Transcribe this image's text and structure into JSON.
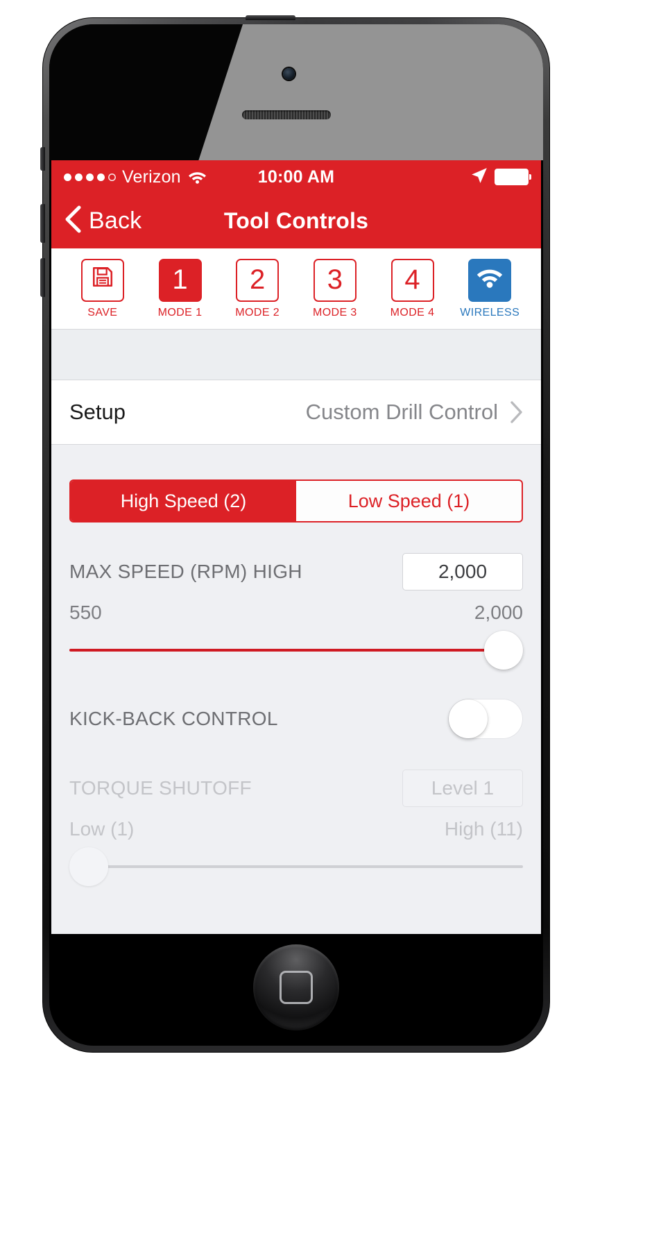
{
  "status_bar": {
    "carrier": "Verizon",
    "time": "10:00 AM",
    "signal_dots_filled": 4,
    "signal_dots_total": 5,
    "wifi_icon": "wifi-icon",
    "location_icon": "location-arrow-icon",
    "battery_icon": "battery-full-icon"
  },
  "nav_bar": {
    "back_label": "Back",
    "back_icon": "chevron-left-icon",
    "title": "Tool Controls"
  },
  "toolbar": {
    "items": [
      {
        "glyph": "",
        "caption": "SAVE",
        "icon": "floppy-disk-save-icon",
        "state": "outline"
      },
      {
        "glyph": "1",
        "caption": "MODE 1",
        "icon": "mode-1-icon",
        "state": "active"
      },
      {
        "glyph": "2",
        "caption": "MODE 2",
        "icon": "mode-2-icon",
        "state": "outline"
      },
      {
        "glyph": "3",
        "caption": "MODE 3",
        "icon": "mode-3-icon",
        "state": "outline"
      },
      {
        "glyph": "4",
        "caption": "MODE 4",
        "icon": "mode-4-icon",
        "state": "outline"
      },
      {
        "glyph": "",
        "caption": "WIRELESS",
        "icon": "wireless-wifi-icon",
        "state": "wireless"
      }
    ]
  },
  "setup_row": {
    "label": "Setup",
    "value": "Custom Drill Control",
    "chevron_icon": "chevron-right-icon"
  },
  "speed_segment": {
    "options": [
      {
        "label": "High Speed (2)",
        "selected": true
      },
      {
        "label": "Low Speed (1)",
        "selected": false
      }
    ]
  },
  "max_speed": {
    "label": "MAX SPEED (RPM) HIGH",
    "value": "2,000",
    "min_label": "550",
    "max_label": "2,000",
    "slider_percent": 100
  },
  "kickback": {
    "label": "KICK-BACK CONTROL",
    "toggle_state": "off"
  },
  "torque_shutoff": {
    "label": "TORQUE SHUTOFF",
    "value": "Level 1",
    "min_label": "Low (1)",
    "max_label": "High (11)",
    "slider_percent": 0,
    "disabled": true
  },
  "colors": {
    "brand_red": "#dc2126",
    "slider_red": "#cf1a22",
    "wireless_blue": "#2a78bd",
    "screen_bg": "#eff0f3",
    "label_gray": "#6d6e72",
    "disabled_gray": "#c3c4c8"
  }
}
